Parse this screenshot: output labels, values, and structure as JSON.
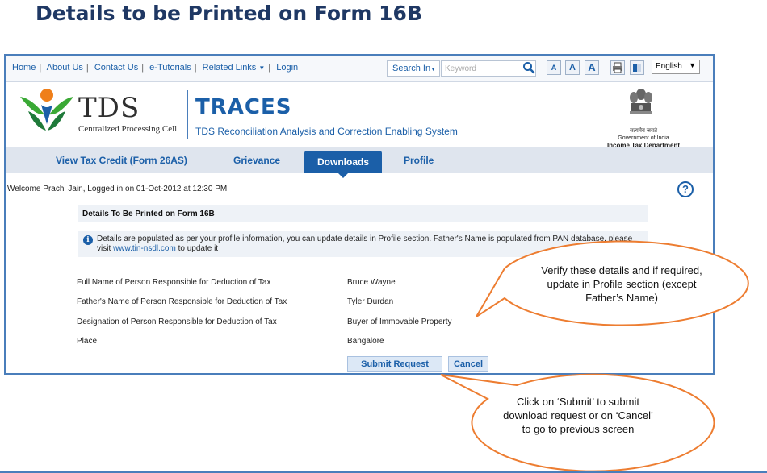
{
  "slide_title": "Details to be Printed on Form 16B",
  "topnav": {
    "links": [
      "Home",
      "About Us",
      "Contact Us",
      "e-Tutorials",
      "Related Links",
      "Login"
    ],
    "related_arrow": "▼",
    "search_label": "Search In",
    "search_placeholder": "Keyword",
    "font_sizes": [
      "A",
      "A",
      "A"
    ],
    "language": "English"
  },
  "header": {
    "tds": "TDS",
    "cpc": "Centralized Processing Cell",
    "traces": "TRACES",
    "traces_sub": "TDS Reconciliation Analysis and Correction Enabling System",
    "gov_hindi": "सत्यमेव जयते",
    "gov_india": "Government of India",
    "dept": "Income Tax Department"
  },
  "tabs": [
    {
      "label": "View Tax Credit (Form 26AS)",
      "active": false
    },
    {
      "label": "Grievance",
      "active": false
    },
    {
      "label": "Downloads",
      "active": true
    },
    {
      "label": "Profile",
      "active": false
    }
  ],
  "welcome": "Welcome Prachi Jain, Logged in on 01-Oct-2012 at 12:30 PM",
  "section_title": "Details To Be Printed on Form 16B",
  "info": {
    "text1": "Details are populated as per your profile information, you can update details in Profile section. Father's Name is populated from PAN database, please visit ",
    "link": "www.tin-nsdl.com",
    "text2": " to update it"
  },
  "fields": [
    {
      "label": "Full Name of Person Responsible for Deduction of Tax",
      "value": "Bruce Wayne"
    },
    {
      "label": "Father's Name of Person Responsible for Deduction of Tax",
      "value": "Tyler Durdan"
    },
    {
      "label": "Designation of Person Responsible for Deduction of Tax",
      "value": "Buyer of Immovable Property"
    },
    {
      "label": "Place",
      "value": "Bangalore"
    }
  ],
  "buttons": {
    "submit": "Submit Request",
    "cancel": "Cancel"
  },
  "callouts": {
    "verify": "Verify these details and if required, update in Profile section (except Father’s Name)",
    "submit": "Click on ‘Submit’ to submit download request or on ‘Cancel’ to go to previous screen"
  },
  "colors": {
    "accent": "#1b5fa8",
    "title": "#1f3864",
    "callout_border": "#ed7d31"
  }
}
